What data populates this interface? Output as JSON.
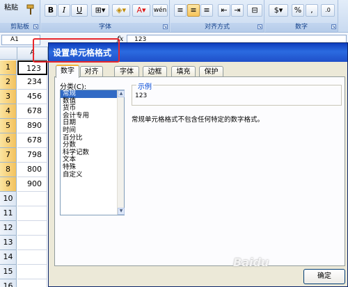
{
  "ribbon": {
    "paste_label": "粘贴",
    "clipboard_label": "剪贴板",
    "font_label": "字体",
    "alignment_label": "对齐方式",
    "number_label": "数字",
    "bold": "B",
    "italic": "I",
    "underline": "U",
    "font_color_glyph": "A",
    "percent": "%",
    "comma": ","
  },
  "formula_bar": {
    "name_box": "A1",
    "fx": "fx",
    "value": "123"
  },
  "sheet": {
    "column_a": "A",
    "rows": [
      {
        "num": "1",
        "value": "123"
      },
      {
        "num": "2",
        "value": "234"
      },
      {
        "num": "3",
        "value": "456"
      },
      {
        "num": "4",
        "value": "678"
      },
      {
        "num": "5",
        "value": "890"
      },
      {
        "num": "6",
        "value": "678"
      },
      {
        "num": "7",
        "value": "798"
      },
      {
        "num": "8",
        "value": "800"
      },
      {
        "num": "9",
        "value": "900"
      },
      {
        "num": "10",
        "value": ""
      },
      {
        "num": "11",
        "value": ""
      },
      {
        "num": "12",
        "value": ""
      },
      {
        "num": "13",
        "value": ""
      },
      {
        "num": "14",
        "value": ""
      },
      {
        "num": "15",
        "value": ""
      },
      {
        "num": "16",
        "value": ""
      }
    ]
  },
  "dialog": {
    "title": "设置单元格格式",
    "tabs": [
      "数字",
      "对齐",
      "字体",
      "边框",
      "填充",
      "保护"
    ],
    "active_tab": "数字",
    "category_label": "分类(C):",
    "categories": [
      "常规",
      "数值",
      "货币",
      "会计专用",
      "日期",
      "时间",
      "百分比",
      "分数",
      "科学记数",
      "文本",
      "特殊",
      "自定义"
    ],
    "selected_category": "常规",
    "sample_legend": "示例",
    "sample_value": "123",
    "description": "常规单元格格式不包含任何特定的数字格式。",
    "ok_button": "确定"
  },
  "watermark": "Baidu",
  "colors": {
    "title_bar": "#1f4fc9",
    "highlight": "#e8262b",
    "selection": "#316ac5",
    "selected_row_header": "#f3c25d"
  }
}
